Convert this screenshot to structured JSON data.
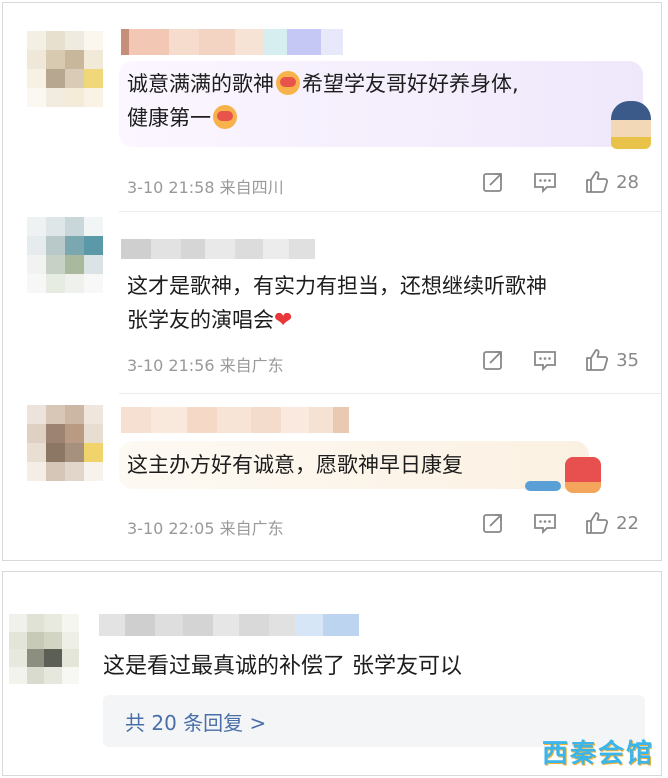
{
  "comments": [
    {
      "text_line1": "诚意满满的歌神",
      "text_line1b": "希望学友哥好好养身体,",
      "text_line2": "健康第一",
      "time": "3-10 21:58",
      "location": "来自四川",
      "likes": "28",
      "emoji": "love-face-emoji"
    },
    {
      "text_line1": "这才是歌神，有实力有担当，还想继续听歌神",
      "text_line2": "张学友的演唱会",
      "heart": "❤",
      "time": "3-10 21:56",
      "location": "来自广东",
      "likes": "35"
    },
    {
      "text_line1": "这主办方好有诚意，愿歌神早日康复",
      "time": "3-10 22:05",
      "location": "来自广东",
      "likes": "22"
    }
  ],
  "bottom_comment": {
    "text": "这是看过最真诚的补偿了  张学友可以",
    "replies_label": "共 20 条回复 >"
  },
  "watermark": "西秦会馆",
  "colors": {
    "bubble1": "#efe8fb",
    "bubble3": "#fbf1e2",
    "link": "#4a6ea8",
    "heart": "#e8383b",
    "meta": "#999999"
  },
  "icons": [
    "share-icon",
    "comment-icon",
    "like-icon"
  ]
}
